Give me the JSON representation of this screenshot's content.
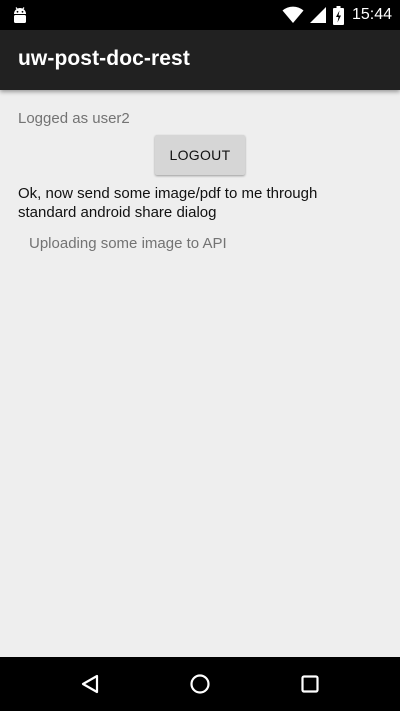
{
  "status_bar": {
    "time": "15:44",
    "icons": [
      "android-debug-icon",
      "wifi-icon",
      "signal-icon",
      "battery-charging-icon"
    ]
  },
  "action_bar": {
    "title": "uw-post-doc-rest"
  },
  "main": {
    "logged_as": "Logged as user2",
    "logout_label": "LOGOUT",
    "instructions": "Ok, now send some image/pdf to me through standard android share dialog",
    "upload_status": "Uploading some image to API"
  },
  "nav_bar": {
    "buttons": [
      "back-icon",
      "home-icon",
      "recents-icon"
    ]
  },
  "colors": {
    "status_bar": "#000000",
    "action_bar": "#212121",
    "background": "#eeeeee",
    "button": "#d6d6d6",
    "secondary_text": "#737373",
    "primary_text": "#111111"
  }
}
